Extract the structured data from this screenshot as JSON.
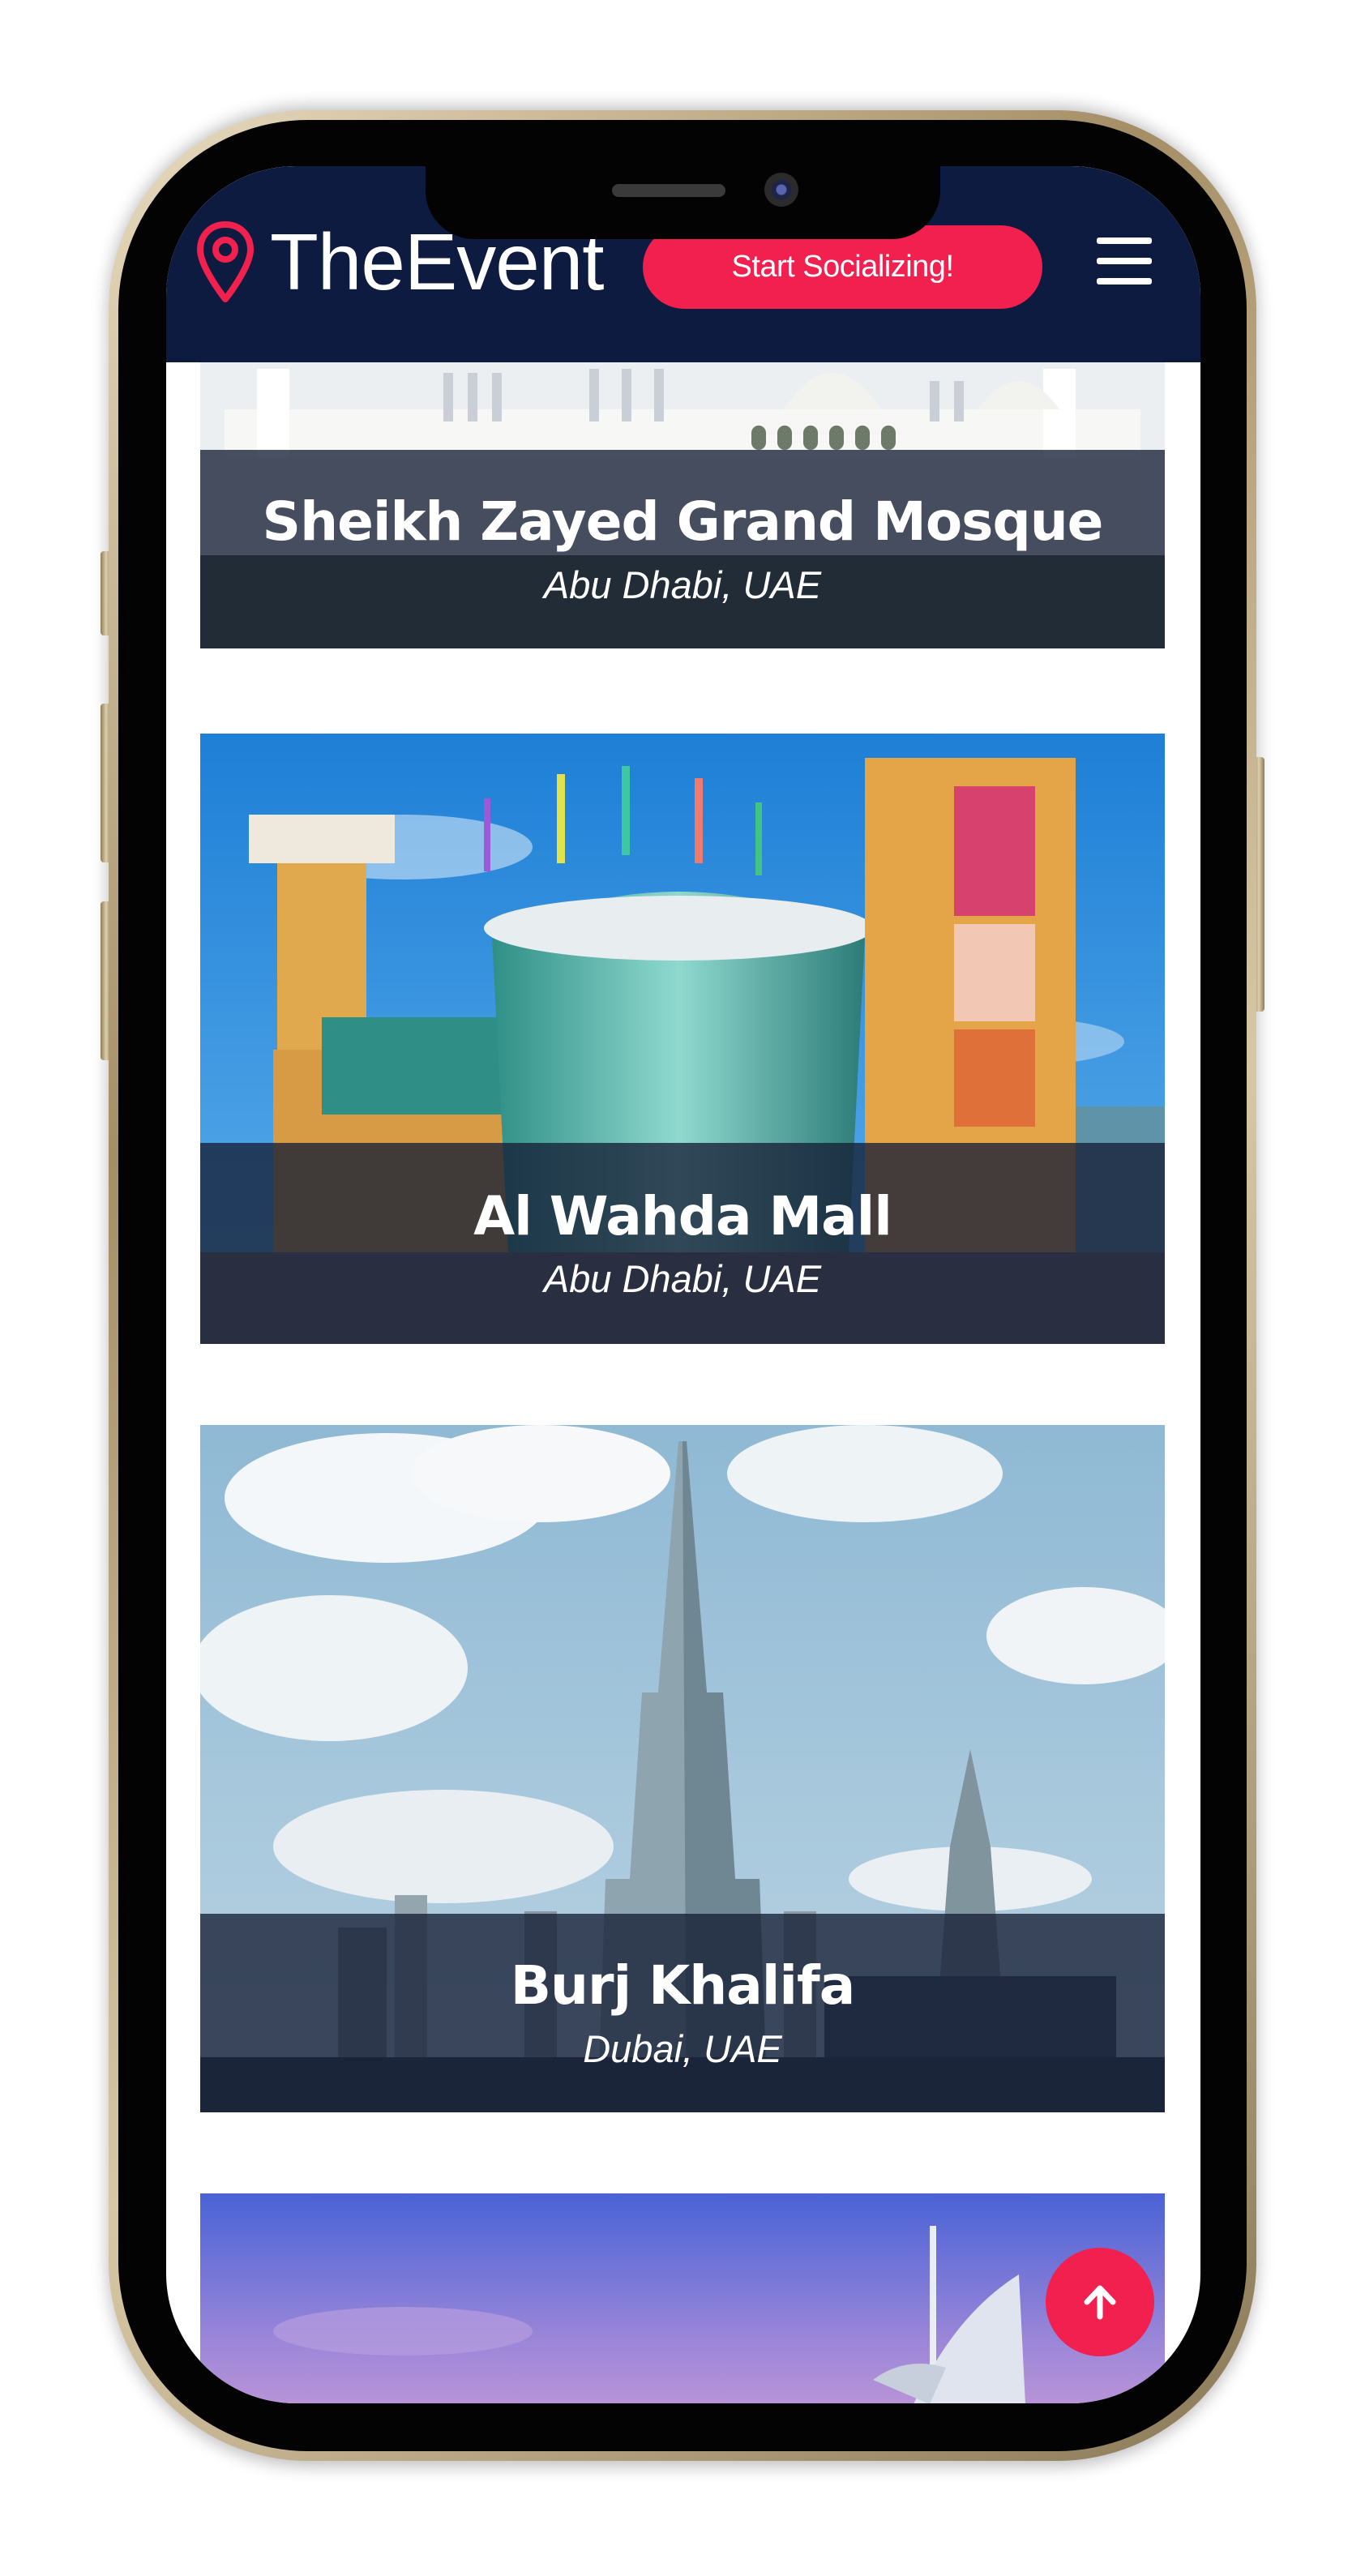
{
  "header": {
    "brand": "TheEvent",
    "cta_label": "Start Socializing!"
  },
  "venues": [
    {
      "title": "Sheikh Zayed Grand Mosque",
      "location": "Abu Dhabi, UAE"
    },
    {
      "title": "Al Wahda Mall",
      "location": "Abu Dhabi, UAE"
    },
    {
      "title": "Burj Khalifa",
      "location": "Dubai, UAE"
    }
  ],
  "colors": {
    "header_bg": "#0c1b3f",
    "accent": "#f1204e",
    "caption_overlay": "#161f36"
  },
  "icons": {
    "brand": "map-pin-icon",
    "menu": "hamburger-menu-icon",
    "back_to_top": "arrow-up-icon"
  }
}
